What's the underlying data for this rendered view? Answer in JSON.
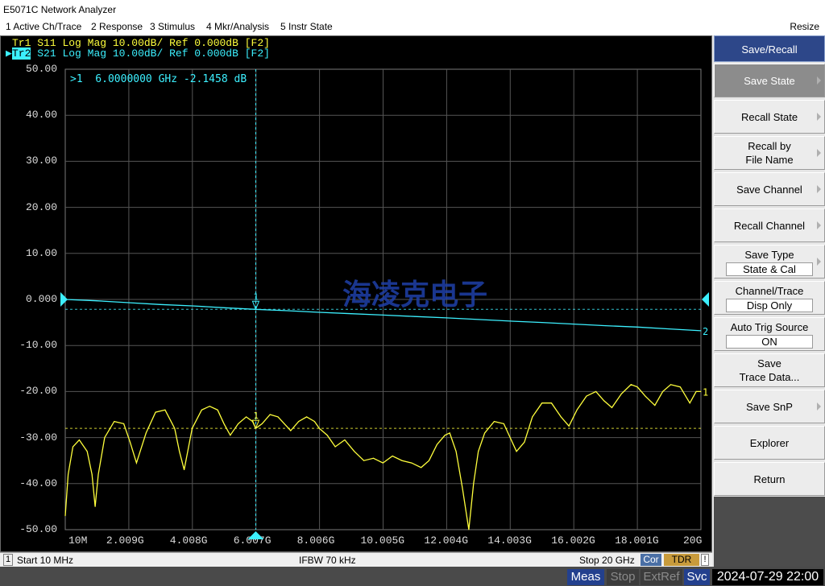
{
  "window": {
    "title": "E5071C Network Analyzer"
  },
  "menu": {
    "items": [
      "1 Active Ch/Trace",
      "2 Response",
      "3 Stimulus",
      "4 Mkr/Analysis",
      "5 Instr State"
    ],
    "resize_label": "Resize"
  },
  "traces": [
    {
      "id": "Tr1",
      "param": "S11",
      "format": "Log Mag",
      "scale": "10.00dB/",
      "ref": "Ref 0.000dB",
      "tag": "[F2]",
      "color": "#ffff3c",
      "active": false
    },
    {
      "id": "Tr2",
      "param": "S21",
      "format": "Log Mag",
      "scale": "10.00dB/",
      "ref": "Ref 0.000dB",
      "tag": "[F2]",
      "color": "#3cf0ff",
      "active": true
    }
  ],
  "marker_readout": ">1  6.0000000 GHz -2.1458 dB",
  "watermark": "海凌克电子",
  "chart_data": {
    "type": "line",
    "y_ticks": [
      "50.00",
      "40.00",
      "30.00",
      "20.00",
      "10.00",
      "0.000",
      "-10.00",
      "-20.00",
      "-30.00",
      "-40.00",
      "-50.00"
    ],
    "x_ticks": [
      "10M",
      "2.009G",
      "4.008G",
      "6.007G",
      "8.006G",
      "10.005G",
      "12.004G",
      "14.003G",
      "16.002G",
      "18.001G",
      "20G"
    ],
    "xlim_ghz": [
      0.01,
      20
    ],
    "ylim_db": [
      -50,
      50
    ],
    "grid": true,
    "reference_level_db": 0,
    "marker": {
      "number": "1",
      "freq_ghz": 6.0,
      "s21_db": -2.1458,
      "s11_db": -28.0
    },
    "series": [
      {
        "name": "S21",
        "trace_label": "2",
        "color": "#3cf0ff",
        "x_ghz": [
          0.01,
          1,
          2,
          3,
          4,
          5,
          6,
          7,
          8,
          9,
          10,
          11,
          12,
          13,
          14,
          15,
          16,
          17,
          18,
          19,
          20
        ],
        "y_db": [
          0.0,
          -0.3,
          -0.7,
          -1.1,
          -1.4,
          -1.8,
          -2.15,
          -2.45,
          -2.8,
          -3.1,
          -3.4,
          -3.7,
          -4.0,
          -4.35,
          -4.7,
          -5.0,
          -5.35,
          -5.7,
          -6.0,
          -6.4,
          -6.8
        ]
      },
      {
        "name": "S11",
        "trace_label": "1",
        "color": "#ffff3c",
        "x_ghz": [
          0.01,
          0.1,
          0.25,
          0.45,
          0.7,
          0.85,
          0.95,
          1.05,
          1.25,
          1.55,
          1.85,
          2.05,
          2.25,
          2.55,
          2.85,
          3.15,
          3.45,
          3.6,
          3.75,
          4.0,
          4.3,
          4.55,
          4.8,
          5.0,
          5.2,
          5.45,
          5.7,
          5.9,
          6.0,
          6.2,
          6.45,
          6.7,
          6.9,
          7.1,
          7.35,
          7.6,
          7.85,
          8.0,
          8.25,
          8.5,
          8.8,
          9.1,
          9.4,
          9.7,
          10.0,
          10.3,
          10.6,
          10.9,
          11.2,
          11.45,
          11.7,
          11.95,
          12.1,
          12.3,
          12.5,
          12.7,
          12.85,
          13.0,
          13.2,
          13.5,
          13.8,
          14.0,
          14.2,
          14.45,
          14.7,
          15.0,
          15.3,
          15.6,
          15.85,
          16.1,
          16.4,
          16.7,
          16.95,
          17.2,
          17.5,
          17.8,
          18.0,
          18.25,
          18.55,
          18.8,
          19.05,
          19.35,
          19.65,
          19.85,
          20.0
        ],
        "y_db": [
          -47.0,
          -38.0,
          -32.0,
          -30.5,
          -33.0,
          -38.0,
          -45.0,
          -38.0,
          -30.0,
          -26.5,
          -27.0,
          -31.0,
          -35.5,
          -29.0,
          -24.5,
          -24.0,
          -28.0,
          -33.0,
          -37.0,
          -28.0,
          -24.0,
          -23.2,
          -24.0,
          -27.0,
          -29.5,
          -27.0,
          -25.5,
          -26.5,
          -28.0,
          -27.0,
          -25.0,
          -25.5,
          -27.0,
          -28.5,
          -26.5,
          -25.5,
          -26.5,
          -28.0,
          -29.5,
          -32.0,
          -30.5,
          -33.0,
          -35.0,
          -34.5,
          -35.5,
          -34.0,
          -35.0,
          -35.5,
          -36.5,
          -35.0,
          -31.5,
          -29.5,
          -29.0,
          -33.0,
          -41.0,
          -50.0,
          -40.0,
          -33.0,
          -29.0,
          -26.5,
          -27.0,
          -30.0,
          -33.0,
          -31.0,
          -25.5,
          -22.5,
          -22.5,
          -25.5,
          -27.5,
          -24.0,
          -21.0,
          -20.0,
          -22.0,
          -23.5,
          -20.5,
          -18.5,
          -19.0,
          -21.0,
          -23.0,
          -20.0,
          -18.5,
          -19.0,
          -22.5,
          -20.0,
          -20.0
        ]
      }
    ]
  },
  "status": {
    "channel": "1",
    "start": "Start 10 MHz",
    "ifbw": "IFBW 70 kHz",
    "stop": "Stop 20 GHz",
    "cor": "Cor",
    "tdr": "TDR",
    "excl": "!"
  },
  "bottom": {
    "meas": "Meas",
    "stop": "Stop",
    "extref": "ExtRef",
    "svc": "Svc",
    "clock": "2024-07-29 22:00"
  },
  "softkeys": {
    "title": "Save/Recall",
    "keys": [
      {
        "label": "Save State",
        "selected": true
      },
      {
        "label": "Recall State"
      },
      {
        "line1": "Recall by",
        "line2": "File Name"
      },
      {
        "label": "Save Channel"
      },
      {
        "label": "Recall Channel"
      },
      {
        "label": "Save Type",
        "value": "State & Cal"
      },
      {
        "label": "Channel/Trace",
        "value": "Disp Only"
      },
      {
        "label": "Auto Trig Source",
        "value": "ON"
      },
      {
        "line1": "Save",
        "line2": "Trace Data..."
      },
      {
        "label": "Save SnP"
      },
      {
        "label": "Explorer"
      },
      {
        "label": "Return"
      }
    ]
  }
}
